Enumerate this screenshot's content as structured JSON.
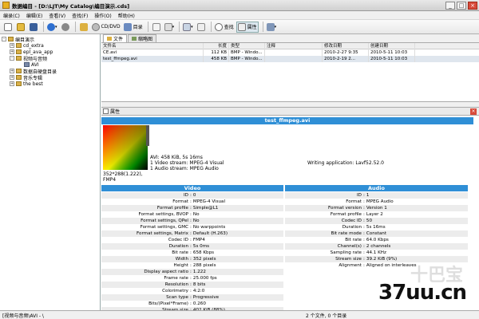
{
  "window": {
    "title": "数据编目 - [D:\\LJT\\My Catalog\\编目演示.cds]"
  },
  "menu": [
    "编录(C)",
    "编辑(E)",
    "查看(V)",
    "查找(F)",
    "操作(O)",
    "帮助(H)"
  ],
  "toolbar": {
    "cd_dvd": "CD/DVD",
    "catalog": "目录",
    "find": "查找",
    "properties": "属性"
  },
  "tree": [
    {
      "label": "编目演示",
      "level": 0,
      "exp": "-"
    },
    {
      "label": "cd_extra",
      "level": 1,
      "exp": "+"
    },
    {
      "label": "epl_ava_app",
      "level": 1,
      "exp": "+"
    },
    {
      "label": "视频与音频",
      "level": 1,
      "exp": "-"
    },
    {
      "label": "AVI",
      "level": 2,
      "exp": ""
    },
    {
      "label": "数据自硬盘目录",
      "level": 1,
      "exp": "+"
    },
    {
      "label": "音乐专辑",
      "level": 1,
      "exp": "+"
    },
    {
      "label": "the best",
      "level": 1,
      "exp": "+"
    }
  ],
  "tabs": [
    "文件",
    "缩略图"
  ],
  "filelist": {
    "headers": [
      "文件名",
      "长度",
      "类型",
      "注释",
      "修改日期",
      "创建日期"
    ],
    "rows": [
      [
        "CE.avi",
        "112 KB",
        "BMP - Windo...",
        "",
        "2010-2-27 9:35",
        "2010-5-11 10:03"
      ],
      [
        "test_ffmpeg.avi",
        "458 KB",
        "BMP - Windo...",
        "",
        "2010-2-19 2...",
        "2010-5-11 10:03"
      ]
    ]
  },
  "props": {
    "tab": "属性",
    "filename": "test_ffmpeg.avi",
    "line1": "AVI: 458 KiB, 5s 16ms",
    "line2": "1 Video stream: MPEG-4 Visual",
    "line3": "1 Audio stream: MPEG Audio",
    "writing": "Writing application: Lavf52.52.0",
    "dims": "352*288(1.222),",
    "codec": "FMP4",
    "video_header": "Video",
    "audio_header": "Audio",
    "video": [
      [
        "ID",
        "0"
      ],
      [
        "Format",
        "MPEG-4 Visual"
      ],
      [
        "Format profile",
        "Simple@L1"
      ],
      [
        "Format settings, BVOP",
        "No"
      ],
      [
        "Format settings, QPel",
        "No"
      ],
      [
        "Format settings, GMC",
        "No warppoints"
      ],
      [
        "Format settings, Matrix",
        "Default (H.263)"
      ],
      [
        "Codec ID",
        "FMP4"
      ],
      [
        "Duration",
        "5s 0ms"
      ],
      [
        "Bit rate",
        "658 Kbps"
      ],
      [
        "Width",
        "352 pixels"
      ],
      [
        "Height",
        "288 pixels"
      ],
      [
        "Display aspect ratio",
        "1.222"
      ],
      [
        "Frame rate",
        "25.000 fps"
      ],
      [
        "Resolution",
        "8 bits"
      ],
      [
        "Colorimetry",
        "4:2:0"
      ],
      [
        "Scan type",
        "Progressive"
      ],
      [
        "Bits/(Pixel*Frame)",
        "0.260"
      ],
      [
        "Stream size",
        "402 KiB (88%)"
      ]
    ],
    "audio": [
      [
        "ID",
        "1"
      ],
      [
        "Format",
        "MPEG Audio"
      ],
      [
        "Format version",
        "Version 1"
      ],
      [
        "Format profile",
        "Layer 2"
      ],
      [
        "Codec ID",
        "50"
      ],
      [
        "Duration",
        "5s 16ms"
      ],
      [
        "Bit rate mode",
        "Constant"
      ],
      [
        "Bit rate",
        "64.0 Kbps"
      ],
      [
        "Channel(s)",
        "2 channels"
      ],
      [
        "Sampling rate",
        "44.1 KHz"
      ],
      [
        "Stream size",
        "39.2 KiB (9%)"
      ],
      [
        "Alignment",
        "Aligned on interleaves"
      ]
    ]
  },
  "status": {
    "left": "[视频与音频\\AVI - \\",
    "right": "2 个文件, 0 个目录"
  },
  "watermark": "37uu.cn",
  "watermark2": "十巴宝"
}
